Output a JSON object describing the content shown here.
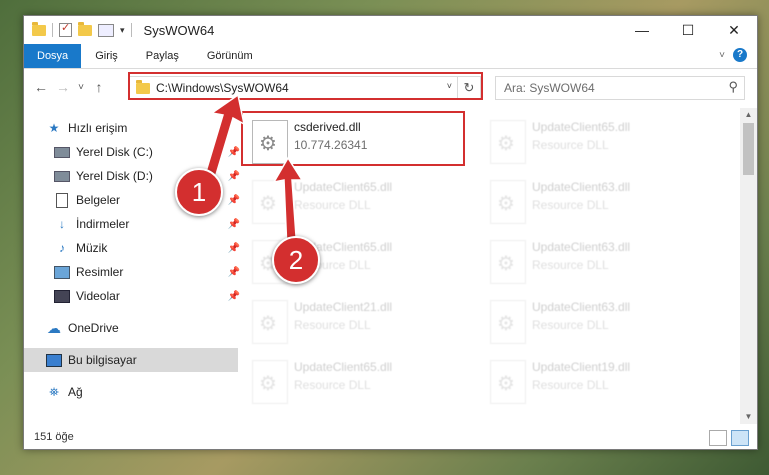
{
  "window": {
    "title": "SysWOW64",
    "minimize_glyph": "—",
    "maximize_glyph": "☐",
    "close_glyph": "✕"
  },
  "ribbon": {
    "tabs": [
      {
        "label": "Dosya",
        "active": true
      },
      {
        "label": "Giriş"
      },
      {
        "label": "Paylaş"
      },
      {
        "label": "Görünüm"
      }
    ],
    "help_label": "?"
  },
  "nav": {
    "back_glyph": "←",
    "forward_glyph": "→",
    "recent_glyph": "˅",
    "up_glyph": "↑",
    "address": "C:\\Windows\\SysWOW64",
    "search_placeholder": "Ara: SysWOW64"
  },
  "sidebar": {
    "items": [
      {
        "label": "Hızlı erişim",
        "icon": "star-icon"
      },
      {
        "label": "Yerel Disk (C:)",
        "icon": "disk-icon",
        "pinned": true
      },
      {
        "label": "Yerel Disk (D:)",
        "icon": "disk-icon",
        "pinned": true
      },
      {
        "label": "Belgeler",
        "icon": "document-icon",
        "pinned": true
      },
      {
        "label": "İndirmeler",
        "icon": "download-icon",
        "pinned": true
      },
      {
        "label": "Müzik",
        "icon": "music-icon",
        "pinned": true
      },
      {
        "label": "Resimler",
        "icon": "pictures-icon",
        "pinned": true
      },
      {
        "label": "Videolar",
        "icon": "videos-icon",
        "pinned": true
      },
      {
        "label": "OneDrive",
        "icon": "cloud-icon"
      },
      {
        "label": "Bu bilgisayar",
        "icon": "computer-icon",
        "selected": true
      },
      {
        "label": "Ağ",
        "icon": "network-icon"
      }
    ]
  },
  "files": [
    {
      "name": "csderived.dll",
      "sub": "10.774.26341",
      "highlight": true
    },
    {
      "name": "UpdateClient65.dll",
      "sub": "Resource DLL"
    },
    {
      "name": "UpdateClient65.dll",
      "sub": "Resource DLL"
    },
    {
      "name": "UpdateClient63.dll",
      "sub": "Resource DLL"
    },
    {
      "name": "UpdateClient65.dll",
      "sub": "Resource DLL"
    },
    {
      "name": "UpdateClient63.dll",
      "sub": "Resource DLL"
    },
    {
      "name": "UpdateClient21.dll",
      "sub": "Resource DLL"
    },
    {
      "name": "UpdateClient63.dll",
      "sub": "Resource DLL"
    },
    {
      "name": "UpdateClient65.dll",
      "sub": "Resource DLL"
    },
    {
      "name": "UpdateClient19.dll",
      "sub": "Resource DLL"
    }
  ],
  "status": {
    "item_count": "151 öğe"
  },
  "annotations": {
    "step1": "1",
    "step2": "2",
    "color": "#d32f2f"
  }
}
